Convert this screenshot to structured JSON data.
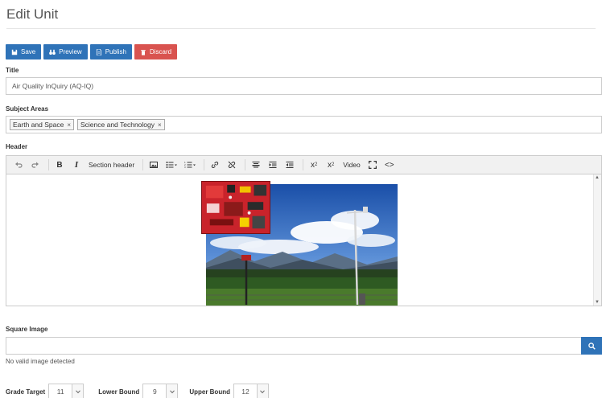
{
  "page": {
    "title": "Edit Unit"
  },
  "actions": {
    "save": "Save",
    "preview": "Preview",
    "publish": "Publish",
    "discard": "Discard"
  },
  "colors": {
    "primary": "#2f73b8",
    "danger": "#d9534f"
  },
  "fields": {
    "title_label": "Title",
    "title_value": "Air Quality InQuiry (AQ-IQ)",
    "subjects_label": "Subject Areas",
    "subjects": [
      "Earth and Space",
      "Science and Technology"
    ],
    "header_label": "Header",
    "square_image_label": "Square Image",
    "square_image_value": "",
    "square_image_hint": "No valid image detected"
  },
  "editor_toolbar": {
    "section_header": "Section header",
    "video": "Video",
    "icons": [
      "undo-icon",
      "redo-icon",
      "bold-icon",
      "italic-icon",
      "image-icon",
      "bullet-list-icon",
      "numbered-list-icon",
      "link-icon",
      "unlink-icon",
      "align-center-icon",
      "indent-icon",
      "outdent-icon",
      "subscript-icon",
      "superscript-icon",
      "fullscreen-icon",
      "code-icon"
    ]
  },
  "bounds": {
    "grade_target_label": "Grade Target",
    "grade_target_value": "11",
    "lower_label": "Lower Bound",
    "lower_value": "9",
    "upper_label": "Upper Bound",
    "upper_value": "12"
  }
}
